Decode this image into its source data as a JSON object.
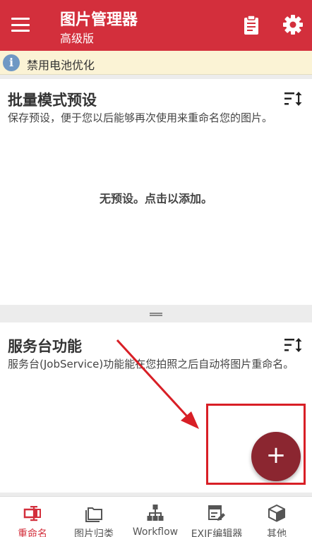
{
  "header": {
    "title": "图片管理器",
    "subtitle": "高级版",
    "icons": [
      "menu-icon",
      "clipboard-icon",
      "gear-icon"
    ]
  },
  "banner": {
    "icon": "info-icon",
    "text": "禁用电池优化"
  },
  "presets": {
    "title": "批量模式预设",
    "description": "保存预设，便于您以后能够再次使用来重命名您的图片。",
    "empty_text": "无预设。点击以添加。"
  },
  "service": {
    "title": "服务台功能",
    "description": "服务台(JobService)功能能在您拍照之后自动将图片重命名。"
  },
  "fab": {
    "label": "+"
  },
  "bottom_nav": {
    "items": [
      {
        "label": "重命名",
        "icon": "rename-icon",
        "active": true
      },
      {
        "label": "图片归类",
        "icon": "folder-icon",
        "active": false
      },
      {
        "label": "Workflow",
        "icon": "workflow-icon",
        "active": false
      },
      {
        "label": "EXIF编辑器",
        "icon": "exif-editor-icon",
        "active": false
      },
      {
        "label": "其他",
        "icon": "cube-icon",
        "active": false
      }
    ]
  },
  "colors": {
    "primary": "#d32f3c",
    "fab": "#8b2630",
    "banner_bg": "#fbf3d5",
    "annotation": "#d81f26"
  }
}
